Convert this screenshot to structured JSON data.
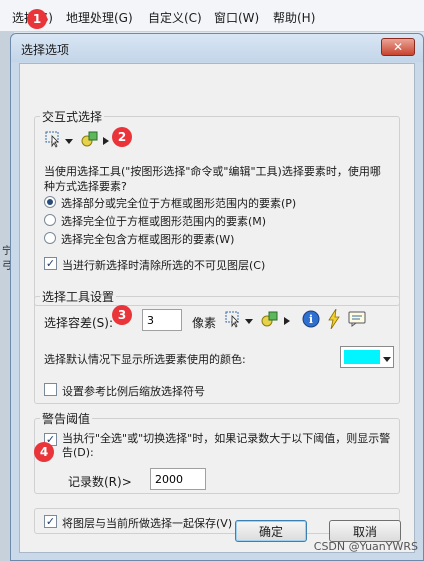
{
  "menubar": {
    "items": [
      "选择(S)",
      "地理处理(G)",
      "自定义(C)",
      "窗口(W)",
      "帮助(H)"
    ]
  },
  "badges": [
    "1",
    "2",
    "3",
    "4"
  ],
  "background_labels": [
    "宁弓"
  ],
  "dialog": {
    "title": "选择选项",
    "close": "✕"
  },
  "interactive": {
    "title": "交互式选择",
    "description": "当使用选择工具(\"按图形选择\"命令或\"编辑\"工具)选择要素时，使用哪种方式选择要素?",
    "options": [
      "选择部分或完全位于方框或图形范围内的要素(P)",
      "选择完全位于方框或图形范围内的要素(M)",
      "选择完全包含方框或图形的要素(W)"
    ],
    "selected_index": 0,
    "clear_invisible_label": "当进行新选择时清除所选的不可见图层(C)",
    "clear_invisible_checked": true
  },
  "tool_settings": {
    "title": "选择工具设置",
    "tolerance_label": "选择容差(S):",
    "tolerance_value": "3",
    "pixel_unit": "像素",
    "color_label": "选择默认情况下显示所选要素使用的颜色:",
    "color_value": "#00f5ff",
    "scale_label": "设置参考比例后缩放选择符号",
    "scale_checked": false
  },
  "warning": {
    "title": "警告阈值",
    "threshold_label": "当执行\"全选\"或\"切换选择\"时，如果记录数大于以下阈值，则显示警告(D):",
    "threshold_checked": true,
    "record_label": "记录数(R)>",
    "record_value": "2000"
  },
  "save_label": "将图层与当前所做选择一起保存(V)",
  "save_checked": true,
  "buttons": {
    "ok": "确定",
    "cancel": "取消"
  },
  "watermark": "CSDN @YuanYWRS"
}
